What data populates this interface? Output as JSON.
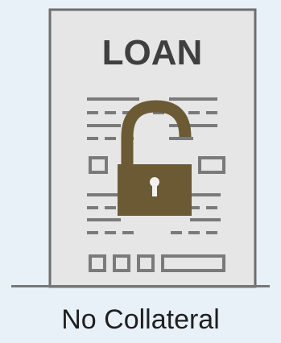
{
  "document": {
    "title": "LOAN"
  },
  "caption": "No Collateral",
  "icons": {
    "document": "loan-document-icon",
    "lock": "open-padlock-icon"
  },
  "colors": {
    "background": "#e8f0f8",
    "paper": "#e6e6e6",
    "paper_border": "#6e6e6e",
    "lines": "#7a7a7a",
    "lock": "#6b5a33",
    "keyhole": "#f1f1f1",
    "caption": "#1f1f1f"
  }
}
